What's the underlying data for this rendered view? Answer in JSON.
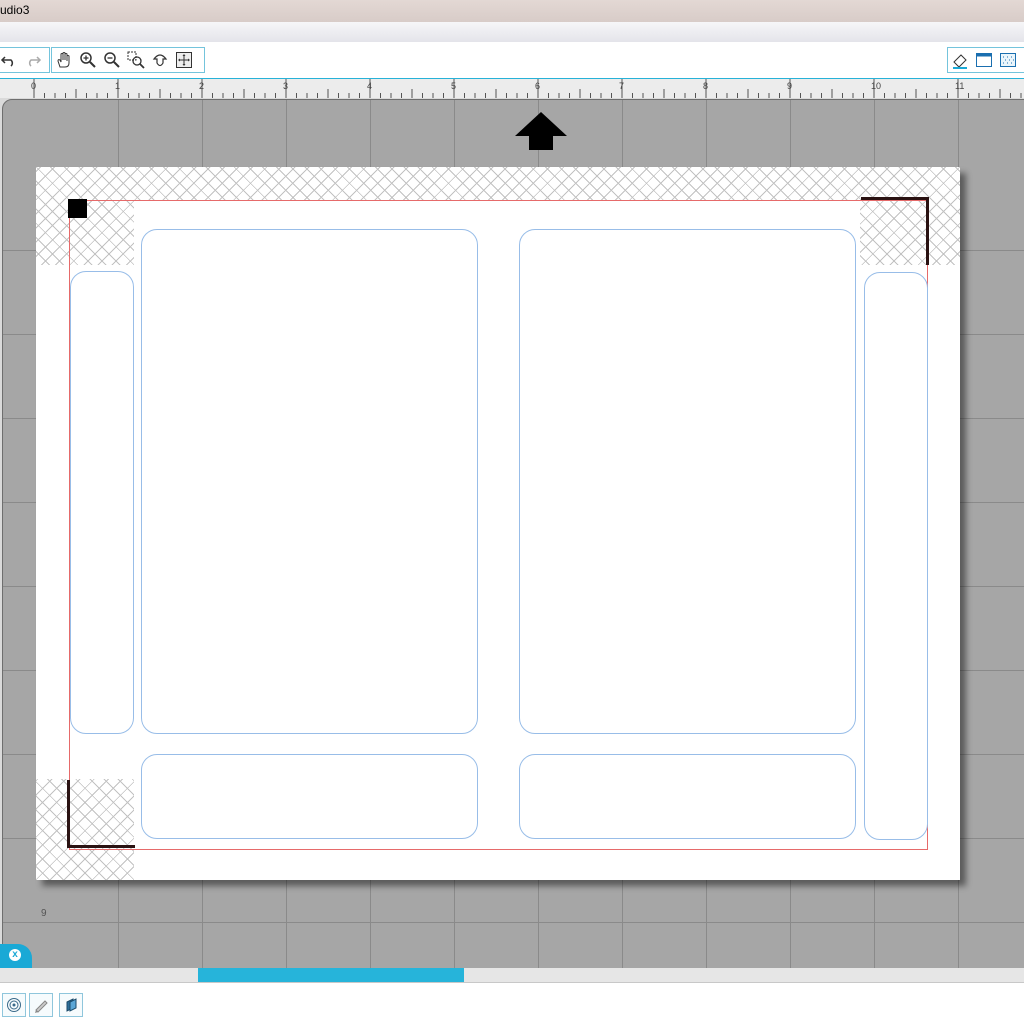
{
  "window": {
    "title": "udio3"
  },
  "toolbar": {
    "left_icons": [
      "undo-icon",
      "redo-icon"
    ],
    "view_icons": [
      "hand-pan-icon",
      "zoom-in-icon",
      "zoom-out-icon",
      "zoom-box-icon",
      "drag-zoom-icon",
      "fit-to-page-icon"
    ],
    "right_icons": [
      "eraser-icon",
      "page-view-icon",
      "grid-pattern-icon"
    ]
  },
  "ruler": {
    "labels": [
      "0",
      "1",
      "2",
      "3",
      "4",
      "5",
      "6",
      "7",
      "8",
      "9",
      "10",
      "11"
    ]
  },
  "mat": {
    "row_number": "9"
  },
  "page_tab": {
    "close_label": "x"
  },
  "bottom_bar": {
    "icons": [
      "registration-icon",
      "pen-icon",
      "layers-icon"
    ]
  },
  "colors": {
    "accent": "#26b4da",
    "cut_border": "#e66a6a",
    "card_outline": "#98bde8",
    "mat": "#a6a6a6"
  }
}
